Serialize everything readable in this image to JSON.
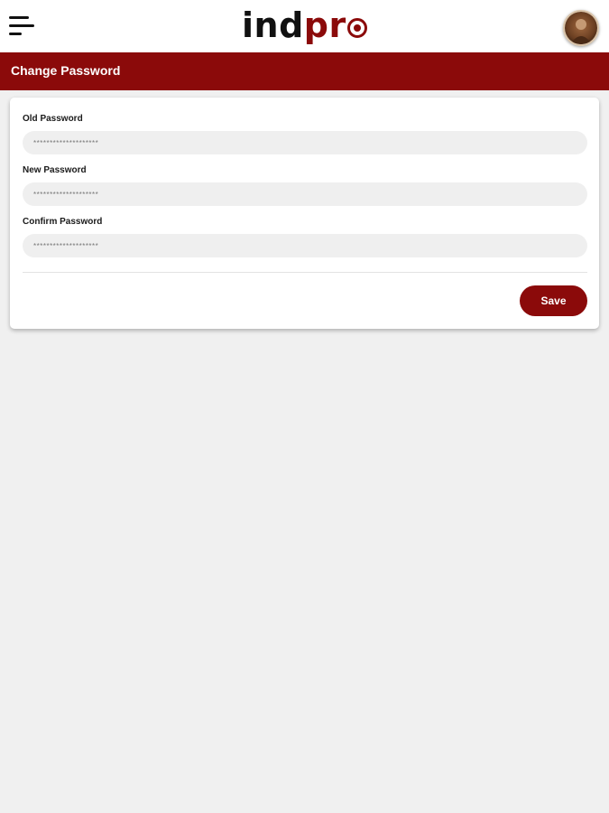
{
  "header": {
    "logo": {
      "part1": "ind",
      "part2": "pr"
    },
    "menu_icon": "hamburger-menu-icon",
    "avatar_icon": "user-avatar"
  },
  "page": {
    "title": "Change Password"
  },
  "form": {
    "old_password": {
      "label": "Old Password",
      "value": "********************"
    },
    "new_password": {
      "label": "New Password",
      "value": "********************"
    },
    "confirm_password": {
      "label": "Confirm Password",
      "value": "********************"
    },
    "save_label": "Save"
  },
  "colors": {
    "brand": "#8b0a0a",
    "background": "#f0f0f0",
    "input_bg": "#efefef"
  }
}
